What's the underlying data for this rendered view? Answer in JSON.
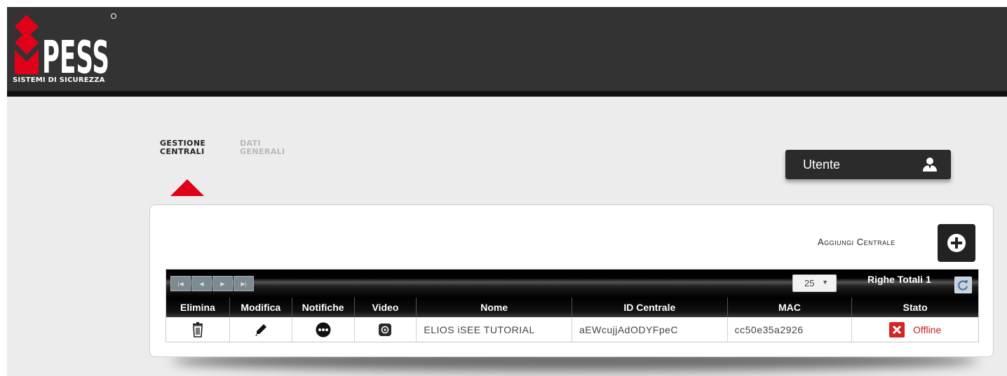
{
  "brand": {
    "logo_text": "PESS",
    "caption": "SISTEMI DI SICUREZZA",
    "colors": {
      "red": "#e0001a",
      "dark": "#333333"
    }
  },
  "nav": {
    "tabs": [
      {
        "label": "GESTIONE CENTRALI",
        "active": true
      },
      {
        "label": "DATI GENERALI",
        "active": false
      }
    ]
  },
  "user": {
    "label": "Utente",
    "icon": "user-icon"
  },
  "panel": {
    "add_label": "Aggiungi Centrale",
    "add_icon": "plus-circle-icon",
    "grid": {
      "pager_buttons": [
        "first-page-icon",
        "prev-page-icon",
        "next-page-icon",
        "last-page-icon"
      ],
      "page_size": "25",
      "total_rows_label": "Righe Totali 1",
      "refresh_icon": "refresh-icon",
      "columns": [
        "Elimina",
        "Modifica",
        "Notifiche",
        "Video",
        "Nome",
        "ID Centrale",
        "MAC",
        "Stato"
      ],
      "rows": [
        {
          "elimina_icon": "trash-icon",
          "modifica_icon": "pencil-icon",
          "notifiche_icon": "notifications-dots-icon",
          "video_icon": "video-icon",
          "nome": "ELIOS iSEE TUTORIAL",
          "id_centrale": "aEWcujjAdODYFpeC",
          "mac": "cc50e35a2926",
          "stato": "Offline",
          "stato_icon": "offline-x-icon",
          "stato_color": "#c81e1e"
        }
      ]
    }
  }
}
